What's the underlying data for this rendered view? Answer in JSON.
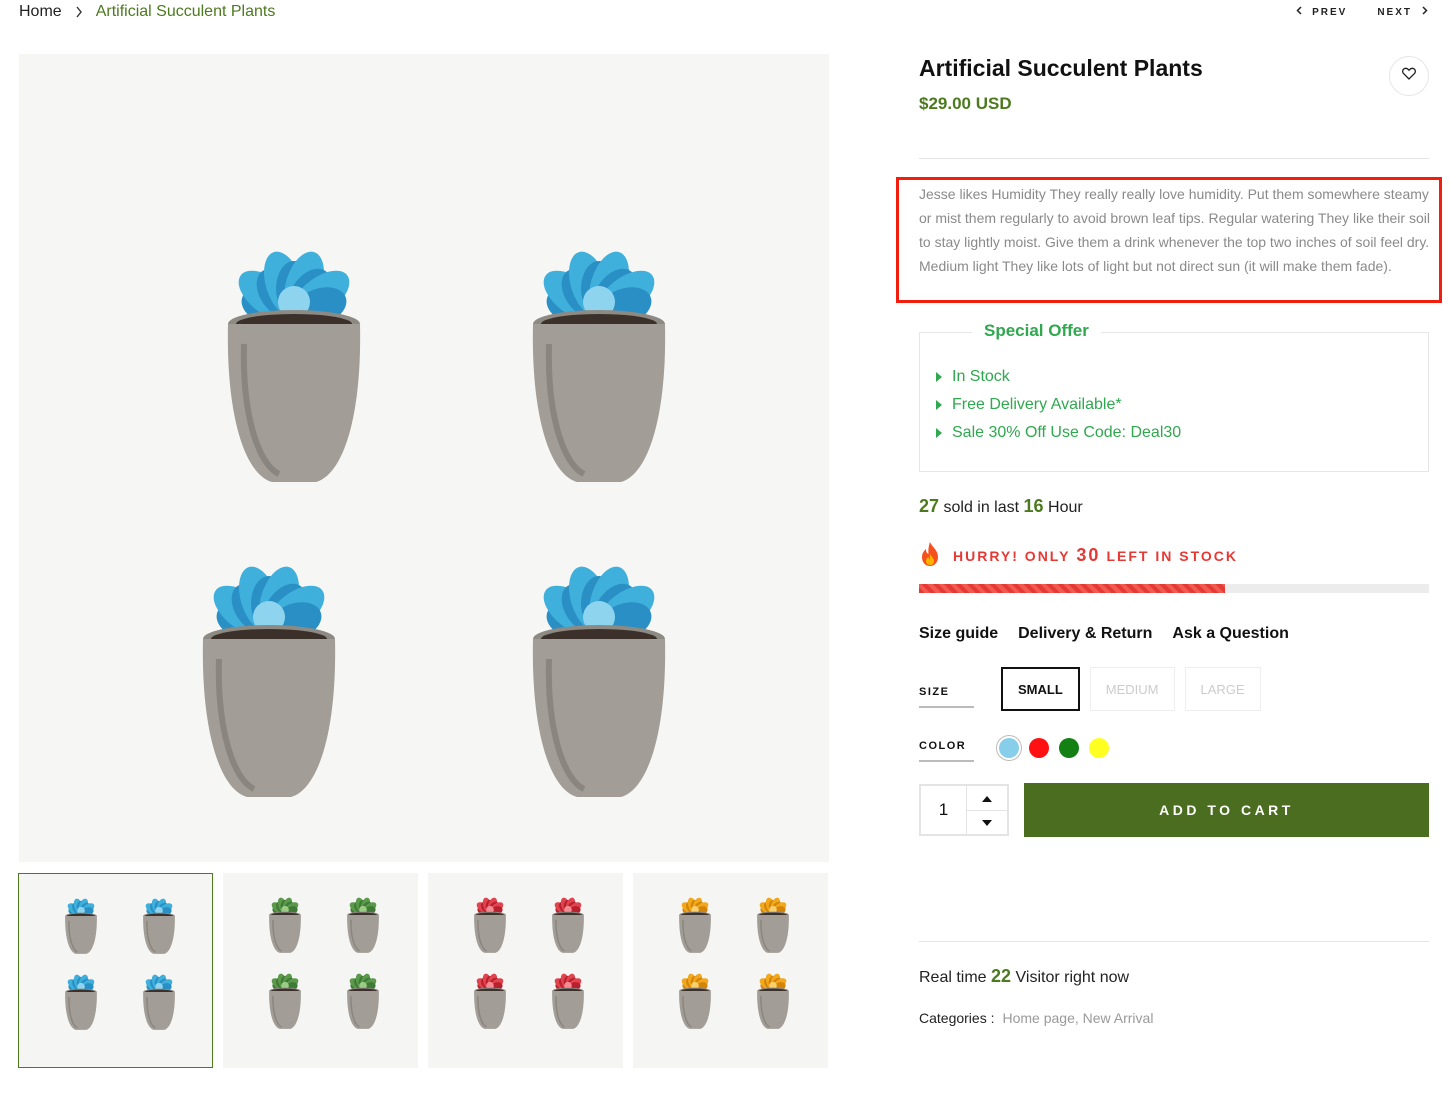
{
  "breadcrumb": {
    "home": "Home",
    "current": "Artificial Succulent Plants"
  },
  "pager": {
    "prev": "PREV",
    "next": "NEXT"
  },
  "product": {
    "title": "Artificial Succulent Plants",
    "price": "$29.00 USD",
    "description": "Jesse likes Humidity They really really love humidity. Put them somewhere steamy or mist them regularly to avoid brown leaf tips. Regular watering They like their soil to stay lightly moist. Give them a drink whenever the top two inches of soil feel dry. Medium light They like lots of light but not direct sun (it will make them fade)."
  },
  "offer": {
    "title": "Special Offer",
    "items": [
      "In Stock",
      "Free Delivery Available*",
      "Sale 30% Off Use Code: Deal30"
    ]
  },
  "sold": {
    "count": "27",
    "text1": "sold in last",
    "hours": "16",
    "text2": "Hour"
  },
  "stock": {
    "prefix": "HURRY! ONLY",
    "count": "30",
    "suffix": "LEFT IN STOCK",
    "level": 0.6
  },
  "tabs": [
    "Size guide",
    "Delivery & Return",
    "Ask a Question"
  ],
  "options": {
    "size_label": "SIZE",
    "sizes": [
      "SMALL",
      "MEDIUM",
      "LARGE"
    ],
    "selected_size": "SMALL",
    "color_label": "COLOR",
    "colors": [
      "#87ceeb",
      "#ff1111",
      "#128012",
      "#ffff22"
    ],
    "selected_color": "#87ceeb"
  },
  "quantity": "1",
  "cart_label": "ADD TO CART",
  "visitors": {
    "text1": "Real time",
    "count": "22",
    "text2": "Visitor right now"
  },
  "categories": {
    "label": "Categories :",
    "values": "Home page, New Arrival"
  },
  "thumb_colors": [
    "blue",
    "green",
    "red",
    "yellow"
  ],
  "colors": {
    "accent_green": "#4d7a1e",
    "offer_green": "#2fa84f",
    "alert_red": "#e53935",
    "highlight_box": "#f11e0e"
  }
}
